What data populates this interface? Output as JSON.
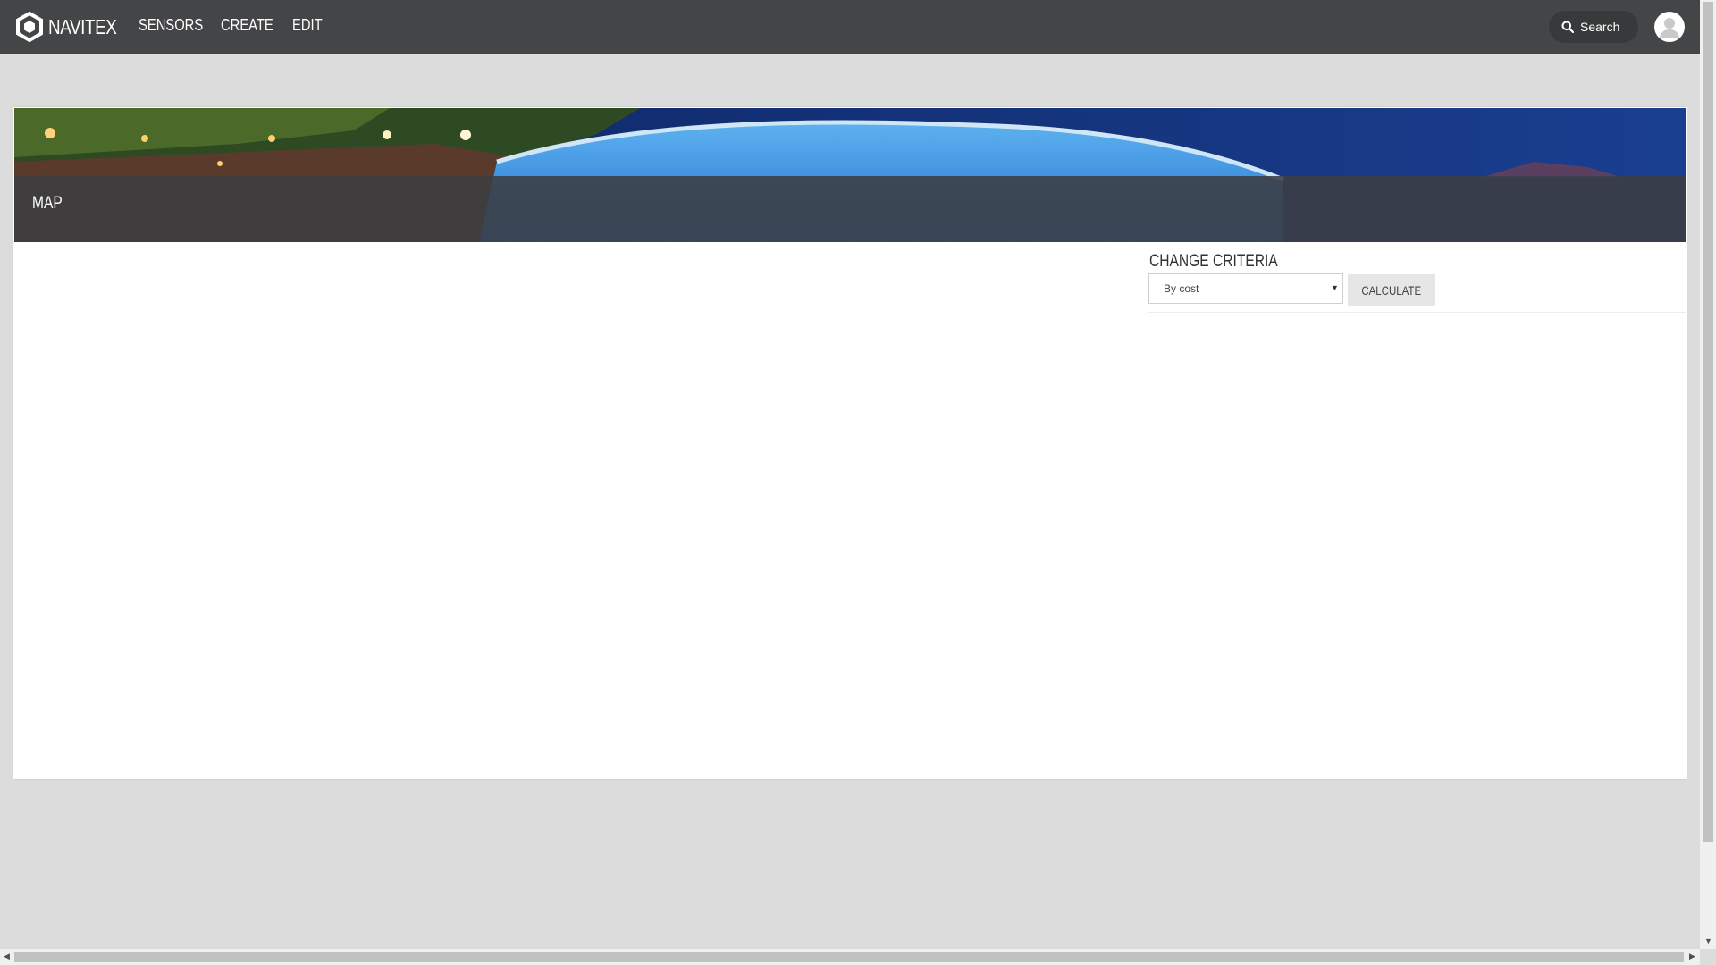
{
  "brand": {
    "name": "NAVITEX"
  },
  "nav": {
    "items": [
      "SENSORS",
      "CREATE",
      "EDIT"
    ]
  },
  "search": {
    "label": "Search"
  },
  "banner": {
    "title": "MAP"
  },
  "criteria": {
    "label": "CHANGE CRITERIA",
    "selected": "By cost",
    "calculate_label": "CALCULATE"
  },
  "colors": {
    "topbar": "#444546",
    "page_background": "#dcdcdc",
    "card": "#ffffff"
  }
}
